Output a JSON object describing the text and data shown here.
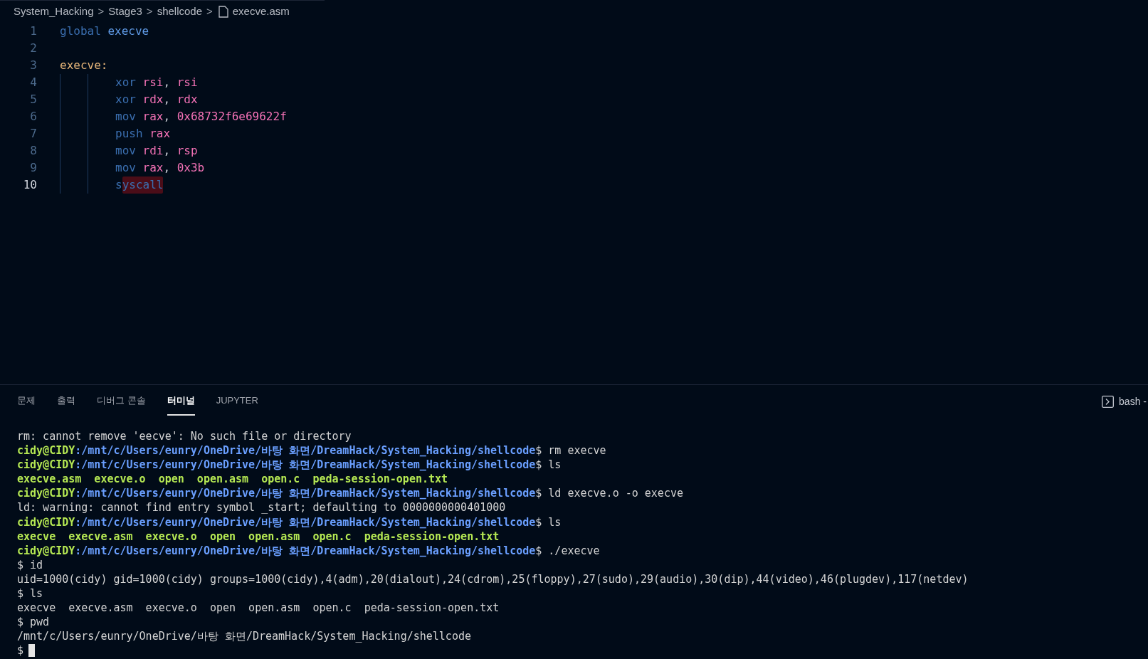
{
  "breadcrumb": {
    "segments": [
      "System_Hacking",
      "Stage3",
      "shellcode"
    ],
    "file": "execve.asm",
    "separator": ">"
  },
  "editor": {
    "lines": [
      {
        "n": "1",
        "active": false,
        "tokens": [
          {
            "text": "global",
            "kind": "keyword"
          },
          {
            "text": "execve",
            "kind": "ident"
          }
        ]
      },
      {
        "n": "2",
        "active": false
      },
      {
        "n": "3",
        "active": false,
        "tokens": [
          {
            "text": "execve:",
            "kind": "label"
          }
        ],
        "children": [
          {
            "n": "4",
            "active": false,
            "tokens": [
              {
                "text": "xor",
                "kind": "keyword"
              },
              {
                "text": "rsi",
                "kind": "register"
              },
              {
                "text": ",",
                "kind": "punct"
              },
              {
                "text": "rsi",
                "kind": "register"
              }
            ]
          },
          {
            "n": "5",
            "active": false,
            "tokens": [
              {
                "text": "xor",
                "kind": "keyword"
              },
              {
                "text": "rdx",
                "kind": "register"
              },
              {
                "text": ",",
                "kind": "punct"
              },
              {
                "text": "rdx",
                "kind": "register"
              }
            ]
          },
          {
            "n": "6",
            "active": false,
            "tokens": [
              {
                "text": "mov",
                "kind": "keyword"
              },
              {
                "text": "rax",
                "kind": "register"
              },
              {
                "text": ",",
                "kind": "punct"
              },
              {
                "text": "0x68732f6e69622f",
                "kind": "number"
              }
            ]
          },
          {
            "n": "7",
            "active": false,
            "tokens": [
              {
                "text": "push",
                "kind": "keyword"
              },
              {
                "text": "rax",
                "kind": "register"
              }
            ]
          },
          {
            "n": "8",
            "active": false,
            "tokens": [
              {
                "text": "mov",
                "kind": "keyword"
              },
              {
                "text": "rdi",
                "kind": "register"
              },
              {
                "text": ",",
                "kind": "punct"
              },
              {
                "text": "rsp",
                "kind": "register"
              }
            ]
          },
          {
            "n": "9",
            "active": false,
            "tokens": [
              {
                "text": "mov",
                "kind": "keyword"
              },
              {
                "text": "rax",
                "kind": "register"
              },
              {
                "text": ",",
                "kind": "punct"
              },
              {
                "text": "0x3b",
                "kind": "number"
              }
            ]
          },
          {
            "n": "10",
            "active": true,
            "tokens": [
              {
                "text": "s",
                "kind": "keyword"
              },
              {
                "text": "yscall",
                "kind": "error"
              }
            ]
          }
        ]
      }
    ]
  },
  "panel": {
    "tabs": [
      {
        "label": "문제",
        "selected": false
      },
      {
        "label": "출력",
        "selected": false
      },
      {
        "label": "디버그 콘솔",
        "selected": false
      },
      {
        "label": "터미널",
        "selected": true
      },
      {
        "label": "JUPYTER",
        "selected": false
      }
    ],
    "terminal_name": "bash -",
    "lines": [
      {
        "kind": "plain",
        "text": "rm: cannot remove 'eecve': No such file or directory"
      },
      {
        "kind": "prompt",
        "user": "cidy@CIDY",
        "path": ":/mnt/c/Users/eunry/OneDrive/바탕 화면/DreamHack/System_Hacking/shellcode",
        "command": "$ rm execve"
      },
      {
        "kind": "prompt",
        "user": "cidy@CIDY",
        "path": ":/mnt/c/Users/eunry/OneDrive/바탕 화면/DreamHack/System_Hacking/shellcode",
        "command": "$ ls"
      },
      {
        "kind": "files",
        "text": "execve.asm  execve.o  open  open.asm  open.c  peda-session-open.txt"
      },
      {
        "kind": "prompt",
        "user": "cidy@CIDY",
        "path": ":/mnt/c/Users/eunry/OneDrive/바탕 화면/DreamHack/System_Hacking/shellcode",
        "command": "$ ld execve.o -o execve"
      },
      {
        "kind": "plain",
        "text": "ld: warning: cannot find entry symbol _start; defaulting to 0000000000401000"
      },
      {
        "kind": "prompt",
        "user": "cidy@CIDY",
        "path": ":/mnt/c/Users/eunry/OneDrive/바탕 화면/DreamHack/System_Hacking/shellcode",
        "command": "$ ls"
      },
      {
        "kind": "files",
        "text": "execve  execve.asm  execve.o  open  open.asm  open.c  peda-session-open.txt"
      },
      {
        "kind": "prompt",
        "user": "cidy@CIDY",
        "path": ":/mnt/c/Users/eunry/OneDrive/바탕 화면/DreamHack/System_Hacking/shellcode",
        "command": "$ ./execve"
      },
      {
        "kind": "plain",
        "text": "$ id"
      },
      {
        "kind": "plain",
        "text": "uid=1000(cidy) gid=1000(cidy) groups=1000(cidy),4(adm),20(dialout),24(cdrom),25(floppy),27(sudo),29(audio),30(dip),44(video),46(plugdev),117(netdev)"
      },
      {
        "kind": "plain",
        "text": "$ ls"
      },
      {
        "kind": "plain",
        "text": "execve  execve.asm  execve.o  open  open.asm  open.c  peda-session-open.txt"
      },
      {
        "kind": "plain",
        "text": "$ pwd"
      },
      {
        "kind": "plain",
        "text": "/mnt/c/Users/eunry/OneDrive/바탕 화면/DreamHack/System_Hacking/shellcode"
      },
      {
        "kind": "cursor",
        "text": "$"
      }
    ]
  }
}
